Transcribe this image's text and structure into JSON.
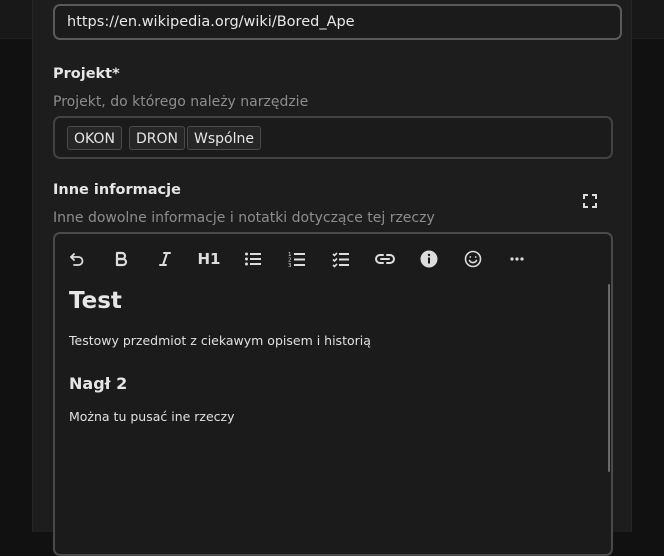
{
  "url_field": {
    "value": "https://en.wikipedia.org/wiki/Bored_Ape"
  },
  "project": {
    "label": "Projekt*",
    "hint": "Projekt, do którego należy narzędzie",
    "tags": [
      "OKON",
      "DRON",
      "Wspólne"
    ]
  },
  "other_info": {
    "label": "Inne informacje",
    "hint": "Inne dowolne informacje i notatki dotyczące tej rzeczy"
  },
  "toolbar": {
    "heading_label": "H1",
    "icons": [
      "undo-icon",
      "bold-icon",
      "italic-icon",
      "heading-1-button",
      "bullet-list-icon",
      "numbered-list-icon",
      "checklist-icon",
      "link-icon",
      "info-icon",
      "emoji-icon",
      "more-icon"
    ]
  },
  "editor": {
    "heading1": "Test",
    "paragraph1": "Testowy przedmiot z ciekawym opisem i historią",
    "heading2": "Nagł 2",
    "paragraph2": "Można tu pusać  ine rzeczy"
  }
}
